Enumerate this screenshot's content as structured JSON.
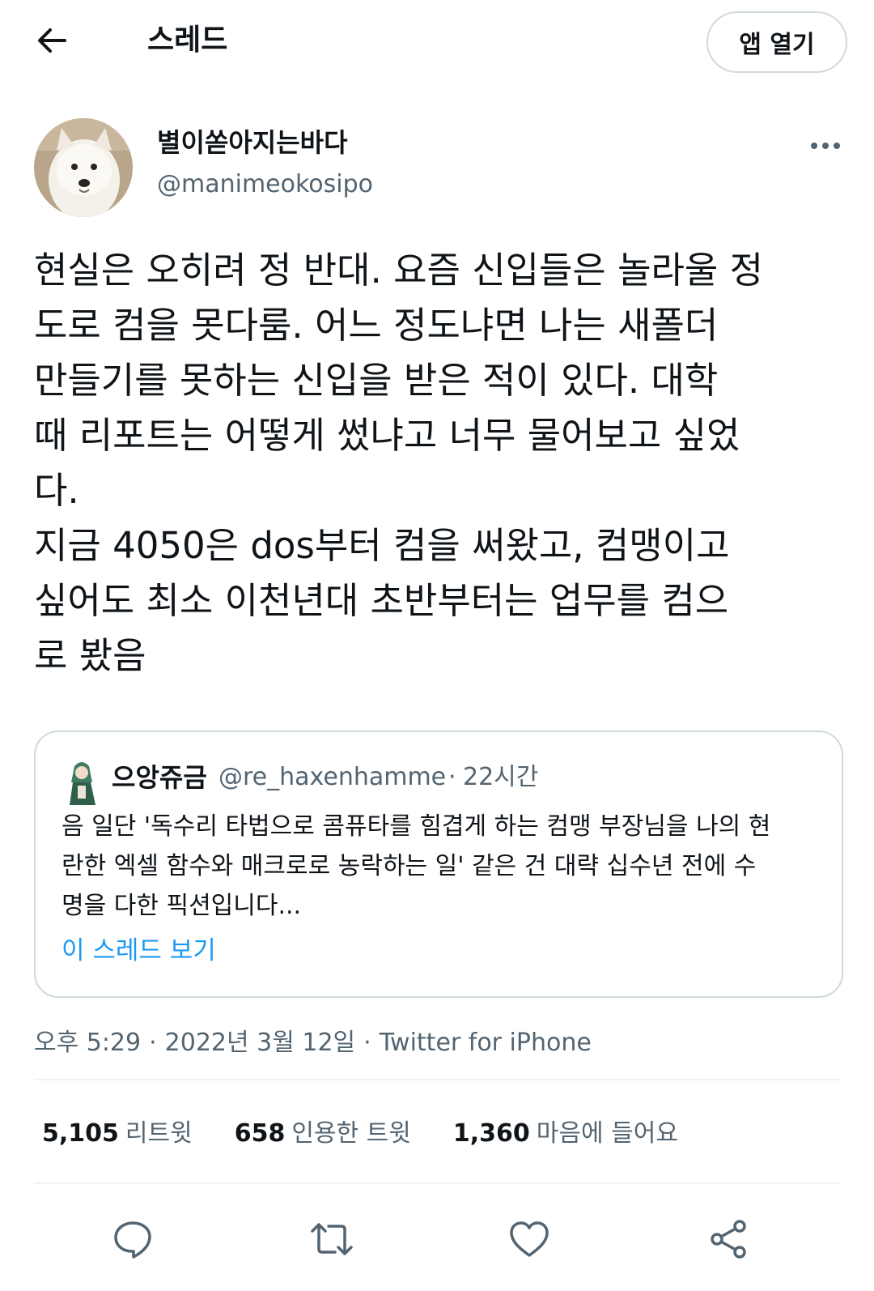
{
  "header": {
    "title": "스레드",
    "open_app_label": "앱 열기",
    "back_icon": "arrow-left-icon"
  },
  "tweet": {
    "author_name": "별이쏟아지는바다",
    "author_handle": "@manimeokosipo",
    "more_icon": "more-horizontal-icon",
    "lines": [
      "현실은 오히려 정 반대. 요즘 신입들은 놀라울 정",
      "도로 컴을 못다룸. 어느 정도냐면 나는 새폴더",
      "만들기를 못하는 신입을 받은 적이 있다. 대학",
      "때 리포트는 어떻게 썼냐고 너무 물어보고 싶었",
      "다.",
      "지금 4050은 dos부터 컴을 써왔고, 컴맹이고",
      "싶어도 최소 이천년대 초반부터는 업무를 컴으",
      "로 봤음"
    ],
    "meta": {
      "time": "오후 5:29",
      "date": "2022년 3월 12일",
      "source": "Twitter for iPhone",
      "separator": "·"
    }
  },
  "quote": {
    "author_name": "으앙쥬금",
    "author_handle": "@re_haxenhamme",
    "separator": "·",
    "time_ago": "22시간",
    "lines": [
      "음 일단 '독수리 타법으로 콤퓨타를 힘겹게 하는 컴맹 부장님을 나의 현",
      "란한 엑셀 함수와 매크로로 농락하는 일' 같은 건 대략 십수년 전에 수",
      "명을 다한 픽션입니다..."
    ],
    "link_label": "이 스레드 보기"
  },
  "stats": {
    "retweets": {
      "count": "5,105",
      "label": "리트윗"
    },
    "quotes": {
      "count": "658",
      "label": "인용한 트윗"
    },
    "likes": {
      "count": "1,360",
      "label": "마음에 들어요"
    }
  },
  "actions": [
    "reply-icon",
    "retweet-icon",
    "like-icon",
    "share-icon"
  ],
  "colors": {
    "text": "#0f1419",
    "secondary": "#536471",
    "link": "#1d9bf0",
    "border": "#cfd9de",
    "divider": "#eff3f4"
  }
}
